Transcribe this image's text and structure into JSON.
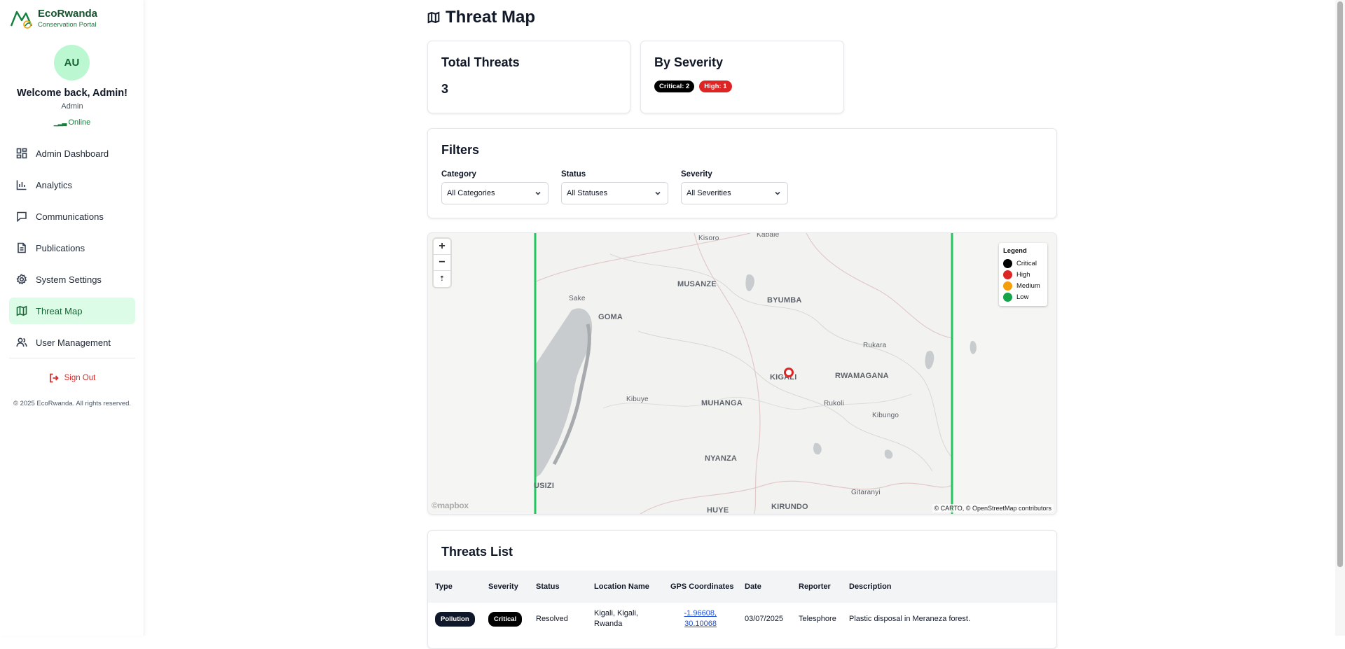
{
  "brand": {
    "name": "EcoRwanda",
    "subtitle": "Conservation Portal"
  },
  "user": {
    "initials": "AU",
    "welcome": "Welcome back, Admin!",
    "role": "Admin",
    "status": "Online"
  },
  "nav": {
    "items": [
      {
        "label": "Admin Dashboard",
        "icon": "dashboard-icon"
      },
      {
        "label": "Analytics",
        "icon": "bar-chart-icon"
      },
      {
        "label": "Communications",
        "icon": "message-icon"
      },
      {
        "label": "Publications",
        "icon": "document-icon"
      },
      {
        "label": "System Settings",
        "icon": "gear-icon"
      },
      {
        "label": "Threat Map",
        "icon": "map-icon",
        "active": true
      },
      {
        "label": "User Management",
        "icon": "users-icon"
      }
    ],
    "sign_out": "Sign Out",
    "copyright": "© 2025 EcoRwanda. All rights reserved."
  },
  "page": {
    "title": "Threat Map"
  },
  "stats": {
    "total_title": "Total Threats",
    "total_value": "3",
    "severity_title": "By Severity",
    "severity_badges": [
      "Critical: 2",
      "High: 1"
    ]
  },
  "filters": {
    "title": "Filters",
    "category": {
      "label": "Category",
      "value": "All Categories"
    },
    "status": {
      "label": "Status",
      "value": "All Statuses"
    },
    "severity": {
      "label": "Severity",
      "value": "All Severities"
    }
  },
  "map": {
    "zoom_in": "+",
    "zoom_out": "−",
    "reset": "⇡",
    "legend": {
      "title": "Legend",
      "items": [
        {
          "label": "Critical",
          "color": "#000000"
        },
        {
          "label": "High",
          "color": "#dc2626"
        },
        {
          "label": "Medium",
          "color": "#f59e0b"
        },
        {
          "label": "Low",
          "color": "#16a34a"
        }
      ]
    },
    "attribution": "© CARTO, © OpenStreetMap contributors",
    "logo": "©mapbox",
    "places": [
      "Kisoro",
      "Kabale",
      "Sake",
      "GOMA",
      "MUSANZE",
      "BYUMBA",
      "Rukara",
      "KIGALI",
      "RWAMAGANA",
      "Kibuye",
      "MUHANGA",
      "Rukoli",
      "Kibungo",
      "NYANZA",
      "USIZI",
      "Gitaranyi",
      "HUYE",
      "KIRUNDO"
    ]
  },
  "threats": {
    "title": "Threats List",
    "columns": [
      "Type",
      "Severity",
      "Status",
      "Location Name",
      "GPS Coordinates",
      "Date",
      "Reporter",
      "Description"
    ],
    "rows": [
      {
        "type": "Pollution",
        "severity": "Critical",
        "status": "Resolved",
        "location": "Kigali, Kigali, Rwanda",
        "gps": "-1.96608, 30.10068",
        "date": "03/07/2025",
        "reporter": "Telesphore",
        "description": "Plastic disposal in Meraneza forest."
      }
    ]
  }
}
